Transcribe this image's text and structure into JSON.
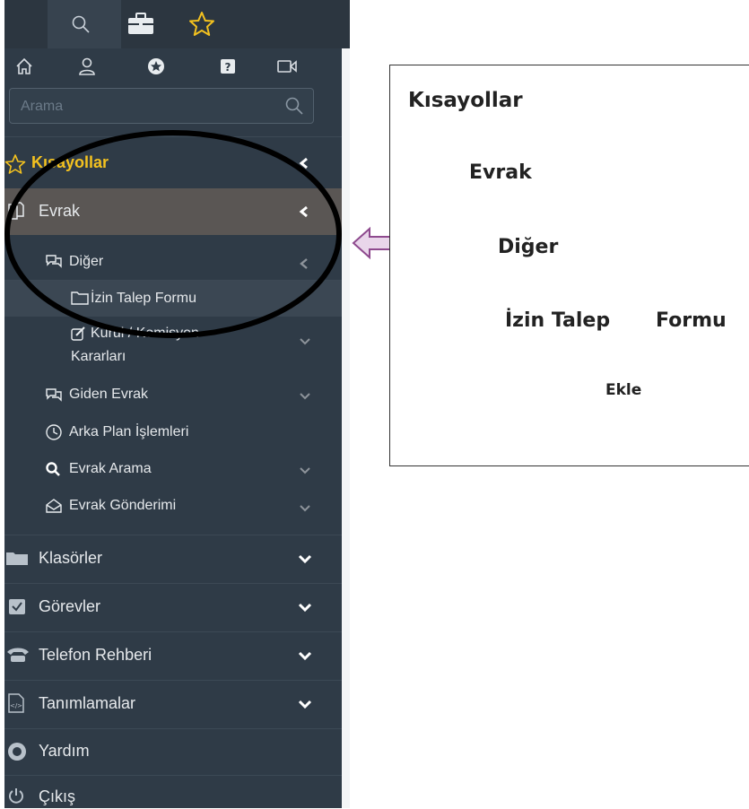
{
  "top_tabs": [
    {
      "icon": "search-icon"
    },
    {
      "icon": "briefcase-icon"
    },
    {
      "icon": "star-icon"
    }
  ],
  "icon_strip": [
    "home-icon",
    "user-icon",
    "star-badge-icon",
    "help-icon",
    "video-icon"
  ],
  "search": {
    "placeholder": "Arama"
  },
  "menu": {
    "kisayollar": "Kısayollar",
    "evrak": "Evrak",
    "diger": "Diğer",
    "izin_talep_formu": "İzin Talep Formu",
    "kurul_line1": "Kurul / Komisyon",
    "kurul_line2": "Kararları",
    "giden_evrak": "Giden Evrak",
    "arka_plan": "Arka Plan İşlemleri",
    "evrak_arama": "Evrak Arama",
    "evrak_gonderimi": "Evrak Gönderimi",
    "klasorler": "Klasörler",
    "gorevler": "Görevler",
    "telefon_rehberi": "Telefon Rehberi",
    "tanimlamalar": "Tanımlamalar",
    "yardim": "Yardım",
    "cikis": "Çıkış"
  },
  "annotation": {
    "kisayollar": "Kısayollar",
    "evrak": "Evrak",
    "diger": "Diğer",
    "izin_talep": "İzin Talep",
    "formu": "Formu",
    "ekle": "Ekle"
  },
  "colors": {
    "sidebar_bg": "#2f3b47",
    "active_row": "#5a5654",
    "highlight_row": "#3b4753",
    "kisayollar_accent": "#f4c21f",
    "arrow_fill": "#e9d6ea",
    "arrow_stroke": "#8e4a8e"
  }
}
